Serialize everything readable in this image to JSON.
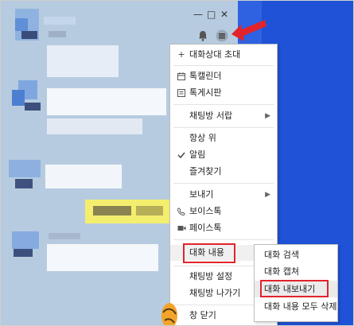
{
  "window": {
    "minimize_symbol": "—",
    "maximize_symbol": "□",
    "close_symbol": "✕"
  },
  "header_icons": [
    "bell-icon",
    "menu-icon"
  ],
  "menu": {
    "items": [
      {
        "label": "대화상대 초대",
        "icon": "+"
      },
      {
        "label": "톡캘린더",
        "icon": "calendar-icon"
      },
      {
        "label": "톡게시판",
        "icon": "board-icon"
      },
      {
        "label": "채팅방 서랍",
        "submenu": true
      },
      {
        "label": "항상 위"
      },
      {
        "label": "알림",
        "checked": true
      },
      {
        "label": "즐겨찾기"
      },
      {
        "label": "보내기",
        "submenu": true
      },
      {
        "label": "보이스톡",
        "icon": "phone-icon"
      },
      {
        "label": "페이스톡",
        "icon": "video-icon"
      },
      {
        "label": "대화 내용",
        "submenu": true,
        "highlighted": true
      },
      {
        "label": "채팅방 설정"
      },
      {
        "label": "채팅방 나가기"
      },
      {
        "label": "창 닫기"
      }
    ],
    "submenu_arrow": "▶"
  },
  "submenu": {
    "items": [
      {
        "label": "대화 검색"
      },
      {
        "label": "대화 캡쳐"
      },
      {
        "label": "대화 내보내기",
        "highlighted": true
      },
      {
        "label": "대화 내용 모두 삭제"
      }
    ]
  },
  "colors": {
    "accent_red": "#e2232b",
    "chat_bg": "#b7cbe0",
    "desktop_blue": "#1f52d6"
  }
}
